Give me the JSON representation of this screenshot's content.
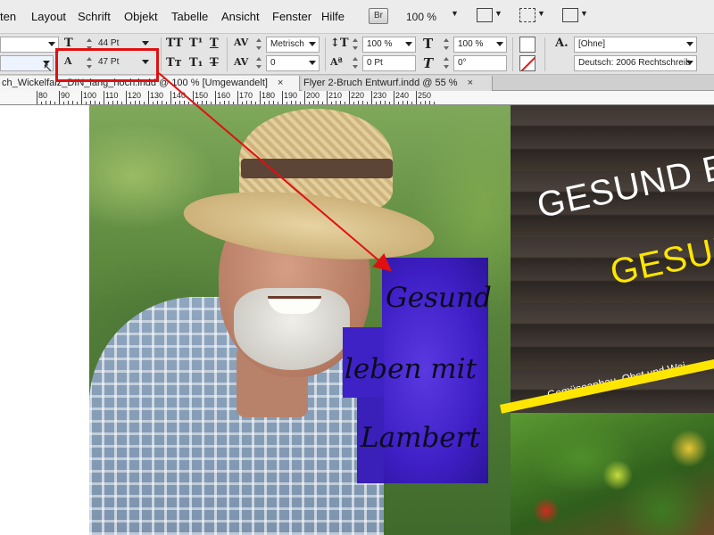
{
  "menubar": {
    "items": [
      "ten",
      "Layout",
      "Schrift",
      "Objekt",
      "Tabelle",
      "Ansicht",
      "Fenster",
      "Hilfe"
    ],
    "bridge_label": "Br",
    "zoom": "100 %"
  },
  "control_panel": {
    "font_size": "44 Pt",
    "leading": "47 Pt",
    "kerning": "Metrisch",
    "tracking": "0",
    "vertical_scale": "100 %",
    "horizontal_scale": "100 %",
    "baseline_shift": "0 Pt",
    "skew": "0°",
    "char_style": "[Ohne]",
    "language": "Deutsch: 2006 Rechtschreib"
  },
  "tabs": [
    {
      "label": "ch_Wickelfalz_DIN_lang_hoch.indd @ 100 % [Umgewandelt]",
      "close": "×"
    },
    {
      "label": "Flyer 2-Bruch Entwurf.indd @ 55 %",
      "close": "×"
    }
  ],
  "ruler": {
    "labels": [
      "80",
      "90",
      "100",
      "110",
      "120",
      "130",
      "140",
      "150",
      "160",
      "170",
      "180",
      "190",
      "200",
      "210",
      "220",
      "230",
      "240",
      "250"
    ]
  },
  "document": {
    "script_lines": [
      "Gesund",
      "leben mit",
      "Lambert"
    ],
    "headline_1": "GESUND E",
    "headline_2": "GESUN",
    "subline": "Gemüseanbau, Obst und Wei"
  },
  "colors": {
    "annotation_red": "#e01010",
    "purple_frame": "#3f1fc6",
    "headline_yellow": "#ffe600",
    "wood_brown": "#3c3430"
  }
}
